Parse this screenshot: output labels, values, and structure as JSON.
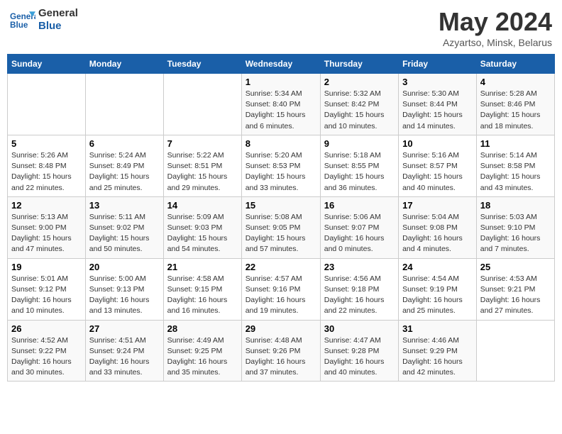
{
  "header": {
    "logo_line1": "General",
    "logo_line2": "Blue",
    "month": "May 2024",
    "location": "Azyartso, Minsk, Belarus"
  },
  "days_of_week": [
    "Sunday",
    "Monday",
    "Tuesday",
    "Wednesday",
    "Thursday",
    "Friday",
    "Saturday"
  ],
  "weeks": [
    [
      {
        "num": "",
        "info": ""
      },
      {
        "num": "",
        "info": ""
      },
      {
        "num": "",
        "info": ""
      },
      {
        "num": "1",
        "info": "Sunrise: 5:34 AM\nSunset: 8:40 PM\nDaylight: 15 hours\nand 6 minutes."
      },
      {
        "num": "2",
        "info": "Sunrise: 5:32 AM\nSunset: 8:42 PM\nDaylight: 15 hours\nand 10 minutes."
      },
      {
        "num": "3",
        "info": "Sunrise: 5:30 AM\nSunset: 8:44 PM\nDaylight: 15 hours\nand 14 minutes."
      },
      {
        "num": "4",
        "info": "Sunrise: 5:28 AM\nSunset: 8:46 PM\nDaylight: 15 hours\nand 18 minutes."
      }
    ],
    [
      {
        "num": "5",
        "info": "Sunrise: 5:26 AM\nSunset: 8:48 PM\nDaylight: 15 hours\nand 22 minutes."
      },
      {
        "num": "6",
        "info": "Sunrise: 5:24 AM\nSunset: 8:49 PM\nDaylight: 15 hours\nand 25 minutes."
      },
      {
        "num": "7",
        "info": "Sunrise: 5:22 AM\nSunset: 8:51 PM\nDaylight: 15 hours\nand 29 minutes."
      },
      {
        "num": "8",
        "info": "Sunrise: 5:20 AM\nSunset: 8:53 PM\nDaylight: 15 hours\nand 33 minutes."
      },
      {
        "num": "9",
        "info": "Sunrise: 5:18 AM\nSunset: 8:55 PM\nDaylight: 15 hours\nand 36 minutes."
      },
      {
        "num": "10",
        "info": "Sunrise: 5:16 AM\nSunset: 8:57 PM\nDaylight: 15 hours\nand 40 minutes."
      },
      {
        "num": "11",
        "info": "Sunrise: 5:14 AM\nSunset: 8:58 PM\nDaylight: 15 hours\nand 43 minutes."
      }
    ],
    [
      {
        "num": "12",
        "info": "Sunrise: 5:13 AM\nSunset: 9:00 PM\nDaylight: 15 hours\nand 47 minutes."
      },
      {
        "num": "13",
        "info": "Sunrise: 5:11 AM\nSunset: 9:02 PM\nDaylight: 15 hours\nand 50 minutes."
      },
      {
        "num": "14",
        "info": "Sunrise: 5:09 AM\nSunset: 9:03 PM\nDaylight: 15 hours\nand 54 minutes."
      },
      {
        "num": "15",
        "info": "Sunrise: 5:08 AM\nSunset: 9:05 PM\nDaylight: 15 hours\nand 57 minutes."
      },
      {
        "num": "16",
        "info": "Sunrise: 5:06 AM\nSunset: 9:07 PM\nDaylight: 16 hours\nand 0 minutes."
      },
      {
        "num": "17",
        "info": "Sunrise: 5:04 AM\nSunset: 9:08 PM\nDaylight: 16 hours\nand 4 minutes."
      },
      {
        "num": "18",
        "info": "Sunrise: 5:03 AM\nSunset: 9:10 PM\nDaylight: 16 hours\nand 7 minutes."
      }
    ],
    [
      {
        "num": "19",
        "info": "Sunrise: 5:01 AM\nSunset: 9:12 PM\nDaylight: 16 hours\nand 10 minutes."
      },
      {
        "num": "20",
        "info": "Sunrise: 5:00 AM\nSunset: 9:13 PM\nDaylight: 16 hours\nand 13 minutes."
      },
      {
        "num": "21",
        "info": "Sunrise: 4:58 AM\nSunset: 9:15 PM\nDaylight: 16 hours\nand 16 minutes."
      },
      {
        "num": "22",
        "info": "Sunrise: 4:57 AM\nSunset: 9:16 PM\nDaylight: 16 hours\nand 19 minutes."
      },
      {
        "num": "23",
        "info": "Sunrise: 4:56 AM\nSunset: 9:18 PM\nDaylight: 16 hours\nand 22 minutes."
      },
      {
        "num": "24",
        "info": "Sunrise: 4:54 AM\nSunset: 9:19 PM\nDaylight: 16 hours\nand 25 minutes."
      },
      {
        "num": "25",
        "info": "Sunrise: 4:53 AM\nSunset: 9:21 PM\nDaylight: 16 hours\nand 27 minutes."
      }
    ],
    [
      {
        "num": "26",
        "info": "Sunrise: 4:52 AM\nSunset: 9:22 PM\nDaylight: 16 hours\nand 30 minutes."
      },
      {
        "num": "27",
        "info": "Sunrise: 4:51 AM\nSunset: 9:24 PM\nDaylight: 16 hours\nand 33 minutes."
      },
      {
        "num": "28",
        "info": "Sunrise: 4:49 AM\nSunset: 9:25 PM\nDaylight: 16 hours\nand 35 minutes."
      },
      {
        "num": "29",
        "info": "Sunrise: 4:48 AM\nSunset: 9:26 PM\nDaylight: 16 hours\nand 37 minutes."
      },
      {
        "num": "30",
        "info": "Sunrise: 4:47 AM\nSunset: 9:28 PM\nDaylight: 16 hours\nand 40 minutes."
      },
      {
        "num": "31",
        "info": "Sunrise: 4:46 AM\nSunset: 9:29 PM\nDaylight: 16 hours\nand 42 minutes."
      },
      {
        "num": "",
        "info": ""
      }
    ]
  ]
}
